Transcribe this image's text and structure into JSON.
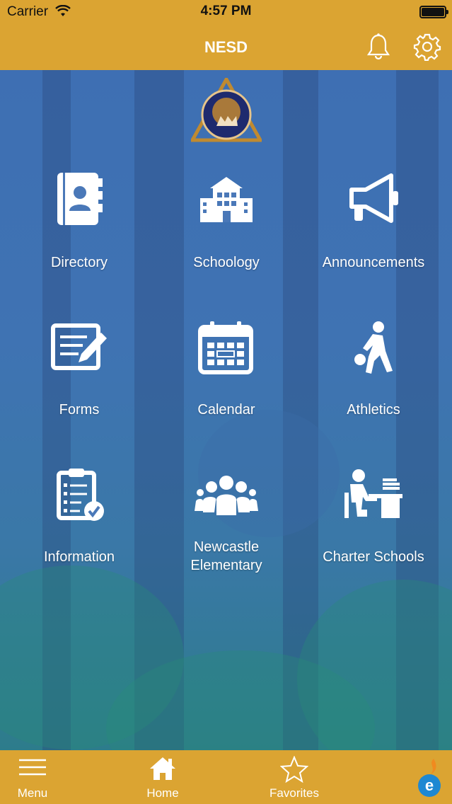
{
  "status_bar": {
    "carrier": "Carrier",
    "time": "4:57 PM"
  },
  "nav": {
    "title": "NESD"
  },
  "tiles": [
    {
      "label": "Directory",
      "icon": "directory-icon"
    },
    {
      "label": "Schoology",
      "icon": "school-building-icon"
    },
    {
      "label": "Announcements",
      "icon": "megaphone-icon"
    },
    {
      "label": "Forms",
      "icon": "form-edit-icon"
    },
    {
      "label": "Calendar",
      "icon": "calendar-icon"
    },
    {
      "label": "Athletics",
      "icon": "basketball-player-icon"
    },
    {
      "label": "Information",
      "icon": "clipboard-check-icon"
    },
    {
      "label": "Newcastle\nElementary",
      "icon": "group-people-icon"
    },
    {
      "label": "Charter Schools",
      "icon": "student-desk-icon"
    }
  ],
  "tab_bar": {
    "menu": "Menu",
    "home": "Home",
    "favorites": "Favorites"
  },
  "colors": {
    "brand_gold": "#dba432",
    "white": "#ffffff"
  }
}
